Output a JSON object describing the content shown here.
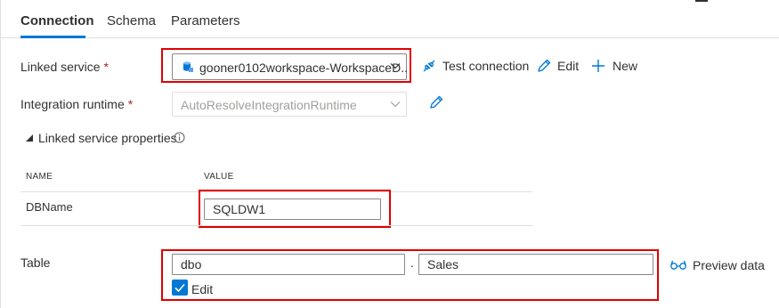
{
  "tabs": [
    {
      "label": "Connection",
      "active": true
    },
    {
      "label": "Schema",
      "active": false
    },
    {
      "label": "Parameters",
      "active": false
    }
  ],
  "linked_service": {
    "label": "Linked service",
    "required_mark": "*",
    "value": "gooner0102workspace-WorkspaceD..",
    "icon": "database-icon"
  },
  "actions": {
    "test_connection": "Test connection",
    "edit": "Edit",
    "new": "New"
  },
  "integration_runtime": {
    "label": "Integration runtime",
    "required_mark": "*",
    "value": "AutoResolveIntegrationRuntime",
    "disabled": true
  },
  "properties": {
    "title": "Linked service properties",
    "columns": [
      "NAME",
      "VALUE"
    ],
    "rows": [
      {
        "name": "DBName",
        "value": "SQLDW1"
      }
    ]
  },
  "table": {
    "label": "Table",
    "schema": "dbo",
    "separator": ".",
    "name": "Sales",
    "preview_label": "Preview data",
    "edit_checkbox": {
      "label": "Edit",
      "checked": true
    }
  },
  "colors": {
    "accent": "#0078d4",
    "highlight_box": "#e00000",
    "required": "#a4262c"
  }
}
